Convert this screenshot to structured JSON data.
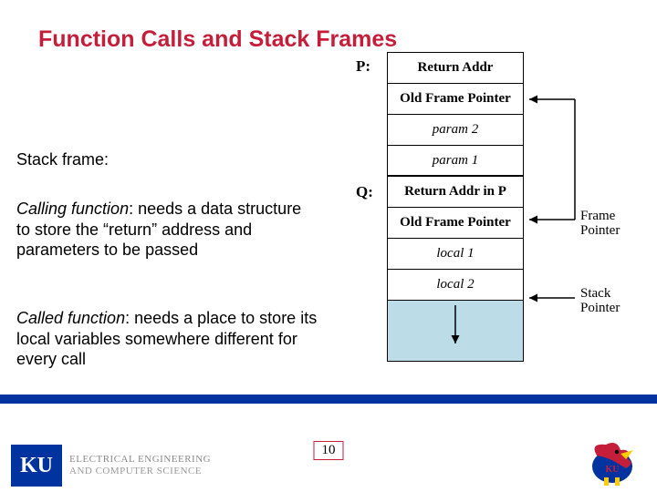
{
  "title": "Function Calls and Stack Frames",
  "stack_frame_label": "Stack frame:",
  "calling_label": "Calling function",
  "calling_text": ": needs a data structure to store the “return” address and parameters to be passed",
  "called_label": "Called function",
  "called_text": ": needs a place to store its local variables somewhere different for every call",
  "diagram": {
    "p_label": "P:",
    "q_label": "Q:",
    "cells": [
      "Return Addr",
      "Old Frame Pointer",
      "param 2",
      "param 1",
      "Return Addr in P",
      "Old Frame Pointer",
      "local 1",
      "local 2"
    ],
    "frame_pointer": "Frame\nPointer",
    "stack_pointer": "Stack\nPointer"
  },
  "page_number": "10",
  "logo": {
    "ku": "KU",
    "dept_line1": "ELECTRICAL ENGINEERING",
    "dept_line2": "AND COMPUTER SCIENCE"
  }
}
